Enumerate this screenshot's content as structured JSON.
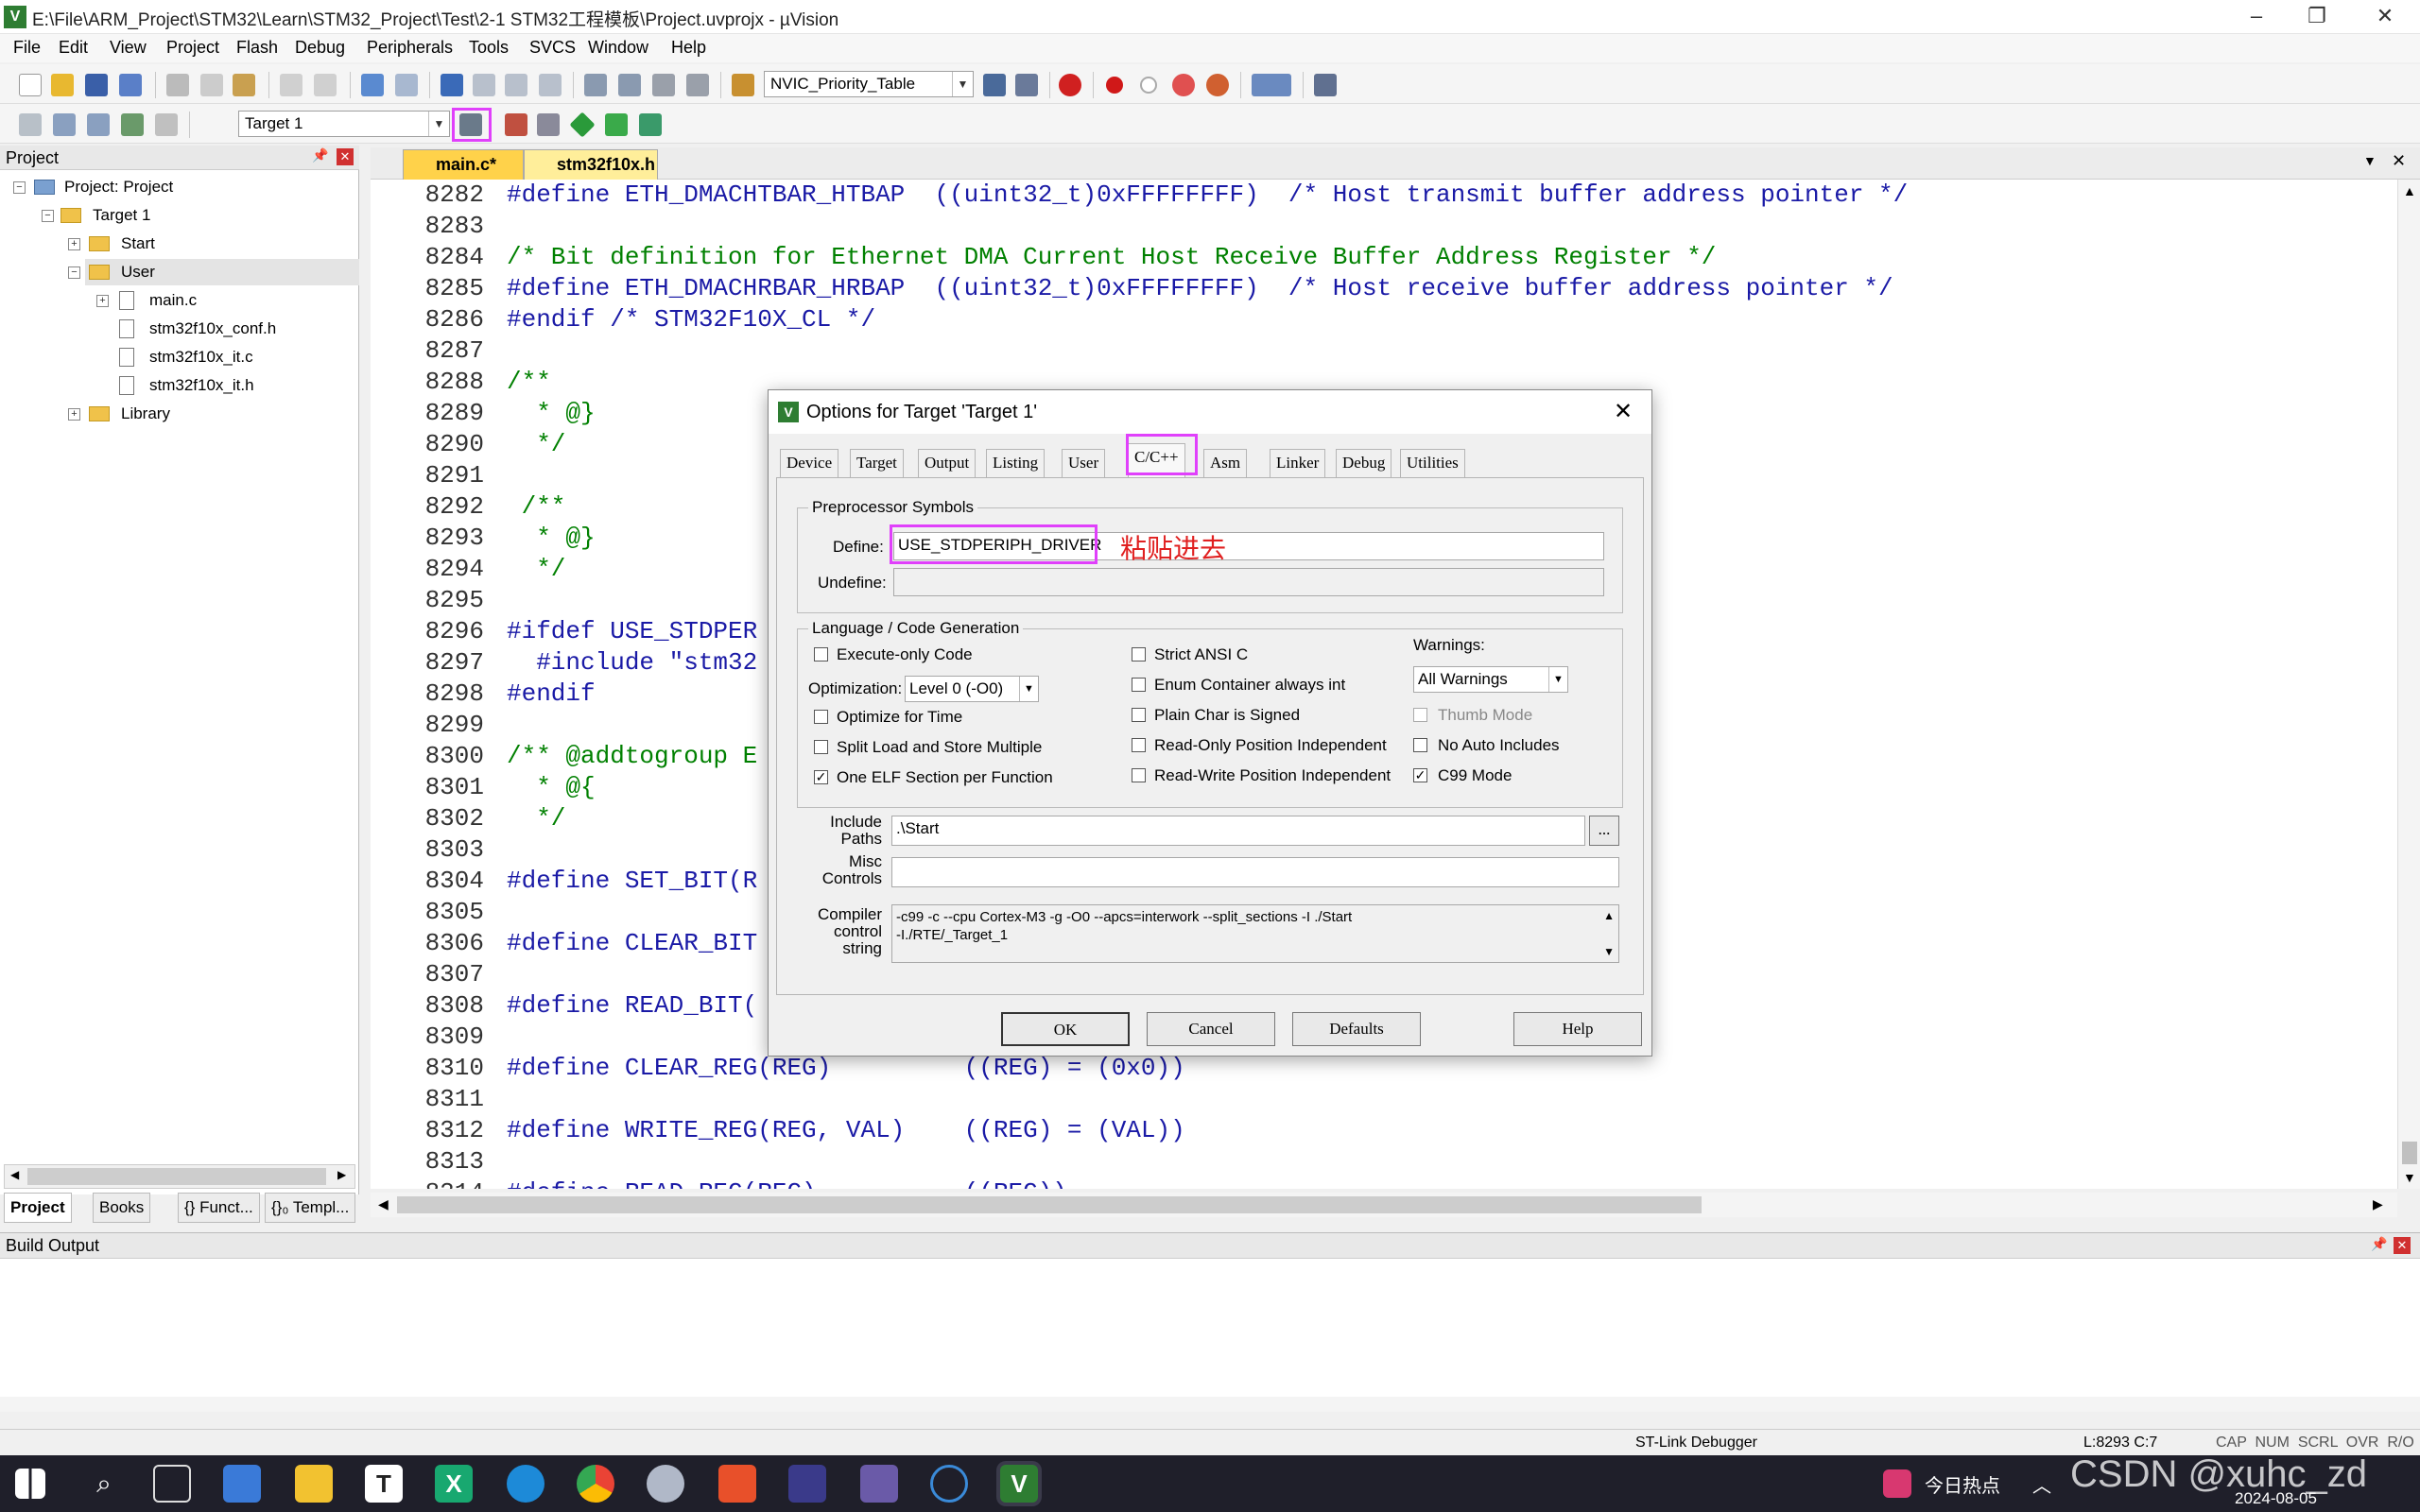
{
  "window": {
    "title": "E:\\File\\ARM_Project\\STM32\\Learn\\STM32_Project\\Test\\2-1 STM32工程模板\\Project.uvprojx - µVision"
  },
  "menu": [
    "File",
    "Edit",
    "View",
    "Project",
    "Flash",
    "Debug",
    "Peripherals",
    "Tools",
    "SVCS",
    "Window",
    "Help"
  ],
  "toolbar": {
    "function_combo": "NVIC_Priority_Table",
    "target_combo": "Target 1"
  },
  "project_panel": {
    "title": "Project",
    "tree": [
      {
        "label": "Project: Project",
        "level": 0
      },
      {
        "label": "Target 1",
        "level": 1
      },
      {
        "label": "Start",
        "level": 2
      },
      {
        "label": "User",
        "level": 2
      },
      {
        "label": "main.c",
        "level": 3
      },
      {
        "label": "stm32f10x_conf.h",
        "level": 3
      },
      {
        "label": "stm32f10x_it.c",
        "level": 3
      },
      {
        "label": "stm32f10x_it.h",
        "level": 3
      },
      {
        "label": "Library",
        "level": 2
      }
    ],
    "tabs": [
      "Project",
      "Books",
      "{} Funct...",
      "{}₀ Templ..."
    ]
  },
  "editor": {
    "tabs": [
      "main.c*",
      "stm32f10x.h"
    ],
    "lines": [
      {
        "n": "8282",
        "t": "#define ETH_DMACHTBAR_HTBAP  ((uint32_t)0xFFFFFFFF)  /* Host transmit buffer address pointer */"
      },
      {
        "n": "8283",
        "t": ""
      },
      {
        "n": "8284",
        "t": "/* Bit definition for Ethernet DMA Current Host Receive Buffer Address Register */"
      },
      {
        "n": "8285",
        "t": "#define ETH_DMACHRBAR_HRBAP  ((uint32_t)0xFFFFFFFF)  /* Host receive buffer address pointer */"
      },
      {
        "n": "8286",
        "t": "#endif /* STM32F10X_CL */"
      },
      {
        "n": "8287",
        "t": ""
      },
      {
        "n": "8288",
        "t": "/**"
      },
      {
        "n": "8289",
        "t": "  * @}"
      },
      {
        "n": "8290",
        "t": "  */"
      },
      {
        "n": "8291",
        "t": ""
      },
      {
        "n": "8292",
        "t": " /**"
      },
      {
        "n": "8293",
        "t": "  * @}"
      },
      {
        "n": "8294",
        "t": "  */"
      },
      {
        "n": "8295",
        "t": ""
      },
      {
        "n": "8296",
        "t": "#ifdef USE_STDPER"
      },
      {
        "n": "8297",
        "t": "  #include \"stm32"
      },
      {
        "n": "8298",
        "t": "#endif"
      },
      {
        "n": "8299",
        "t": ""
      },
      {
        "n": "8300",
        "t": "/** @addtogroup E"
      },
      {
        "n": "8301",
        "t": "  * @{"
      },
      {
        "n": "8302",
        "t": "  */"
      },
      {
        "n": "8303",
        "t": ""
      },
      {
        "n": "8304",
        "t": "#define SET_BIT(R"
      },
      {
        "n": "8305",
        "t": ""
      },
      {
        "n": "8306",
        "t": "#define CLEAR_BIT"
      },
      {
        "n": "8307",
        "t": ""
      },
      {
        "n": "8308",
        "t": "#define READ_BIT("
      },
      {
        "n": "8309",
        "t": ""
      },
      {
        "n": "8310",
        "t": "#define CLEAR_REG(REG)         ((REG) = (0x0))"
      },
      {
        "n": "8311",
        "t": ""
      },
      {
        "n": "8312",
        "t": "#define WRITE_REG(REG, VAL)    ((REG) = (VAL))"
      },
      {
        "n": "8313",
        "t": ""
      },
      {
        "n": "8314",
        "t": "#define READ_REG(REG)          ((REG))"
      }
    ]
  },
  "build_output": {
    "title": "Build Output"
  },
  "status": {
    "debugger": "ST-Link Debugger",
    "position": "L:8293 C:7",
    "flags": "CAP  NUM  SCRL  OVR  R/O"
  },
  "taskbar": {
    "news": "今日热点",
    "date": "2024-08-05",
    "watermark": "CSDN @xuhc_zd"
  },
  "dialog": {
    "title": "Options for Target 'Target 1'",
    "tabs": [
      "Device",
      "Target",
      "Output",
      "Listing",
      "User",
      "C/C++",
      "Asm",
      "Linker",
      "Debug",
      "Utilities"
    ],
    "active_tab": "C/C++",
    "preprocessor": {
      "group": "Preprocessor Symbols",
      "define_label": "Define:",
      "define_value": "USE_STDPERIPH_DRIVER",
      "undefine_label": "Undefine:",
      "undefine_value": "",
      "annotation": "粘贴进去"
    },
    "language": {
      "group": "Language / Code Generation",
      "col1": [
        {
          "label": "Execute-only Code",
          "checked": false
        },
        {
          "label": "Optimize for Time",
          "checked": false
        },
        {
          "label": "Split Load and Store Multiple",
          "checked": false
        },
        {
          "label": "One ELF Section per Function",
          "checked": true
        }
      ],
      "optimization_label": "Optimization:",
      "optimization_value": "Level 0 (-O0)",
      "col2": [
        {
          "label": "Strict ANSI C",
          "checked": false
        },
        {
          "label": "Enum Container always int",
          "checked": false
        },
        {
          "label": "Plain Char is Signed",
          "checked": false
        },
        {
          "label": "Read-Only Position Independent",
          "checked": false
        },
        {
          "label": "Read-Write Position Independent",
          "checked": false
        }
      ],
      "warnings_label": "Warnings:",
      "warnings_value": "All Warnings",
      "col3": [
        {
          "label": "Thumb Mode",
          "checked": false
        },
        {
          "label": "No Auto Includes",
          "checked": false
        },
        {
          "label": "C99 Mode",
          "checked": true
        }
      ]
    },
    "include_label": "Include\nPaths",
    "include_value": ".\\Start",
    "browse": "...",
    "misc_label": "Misc\nControls",
    "misc_value": "",
    "compiler_label": "Compiler\ncontrol\nstring",
    "compiler_value_1": "-c99 -c --cpu Cortex-M3 -g -O0 --apcs=interwork --split_sections -I ./Start",
    "compiler_value_2": "-I./RTE/_Target_1",
    "buttons": {
      "ok": "OK",
      "cancel": "Cancel",
      "defaults": "Defaults",
      "help": "Help"
    }
  }
}
